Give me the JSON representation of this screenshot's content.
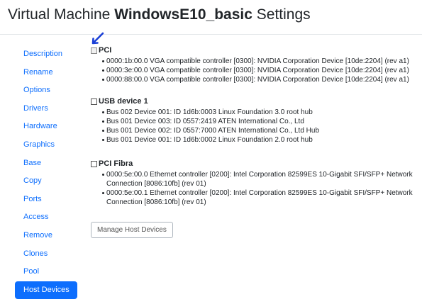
{
  "header": {
    "title_prefix": "Virtual Machine",
    "vm_name": "WindowsE10_basic",
    "title_suffix": "Settings"
  },
  "sidebar": {
    "items": [
      {
        "label": "Description"
      },
      {
        "label": "Rename"
      },
      {
        "label": "Options"
      },
      {
        "label": "Drivers"
      },
      {
        "label": "Hardware"
      },
      {
        "label": "Graphics"
      },
      {
        "label": "Base"
      },
      {
        "label": "Copy"
      },
      {
        "label": "Ports"
      },
      {
        "label": "Access"
      },
      {
        "label": "Remove"
      },
      {
        "label": "Clones"
      },
      {
        "label": "Pool"
      },
      {
        "label": "Host Devices",
        "active": true
      }
    ]
  },
  "sections": [
    {
      "title": "PCI",
      "devices": [
        "0000:1b:00.0 VGA compatible controller [0300]: NVIDIA Corporation Device [10de:2204] (rev a1)",
        "0000:3e:00.0 VGA compatible controller [0300]: NVIDIA Corporation Device [10de:2204] (rev a1)",
        "0000:88:00.0 VGA compatible controller [0300]: NVIDIA Corporation Device [10de:2204] (rev a1)"
      ]
    },
    {
      "title": "USB device 1",
      "devices": [
        "Bus 002 Device 001: ID 1d6b:0003 Linux Foundation 3.0 root hub",
        "Bus 001 Device 003: ID 0557:2419 ATEN International Co., Ltd",
        "Bus 001 Device 002: ID 0557:7000 ATEN International Co., Ltd Hub",
        "Bus 001 Device 001: ID 1d6b:0002 Linux Foundation 2.0 root hub"
      ]
    },
    {
      "title": "PCI Fibra",
      "devices": [
        "0000:5e:00.0 Ethernet controller [0200]: Intel Corporation 82599ES 10-Gigabit SFI/SFP+ Network Connection [8086:10fb] (rev 01)",
        "0000:5e:00.1 Ethernet controller [0200]: Intel Corporation 82599ES 10-Gigabit SFI/SFP+ Network Connection [8086:10fb] (rev 01)"
      ]
    }
  ],
  "actions": {
    "manage_label": "Manage Host Devices"
  },
  "colors": {
    "accent": "#0d6efd",
    "cursor": "#1a3fd6"
  }
}
